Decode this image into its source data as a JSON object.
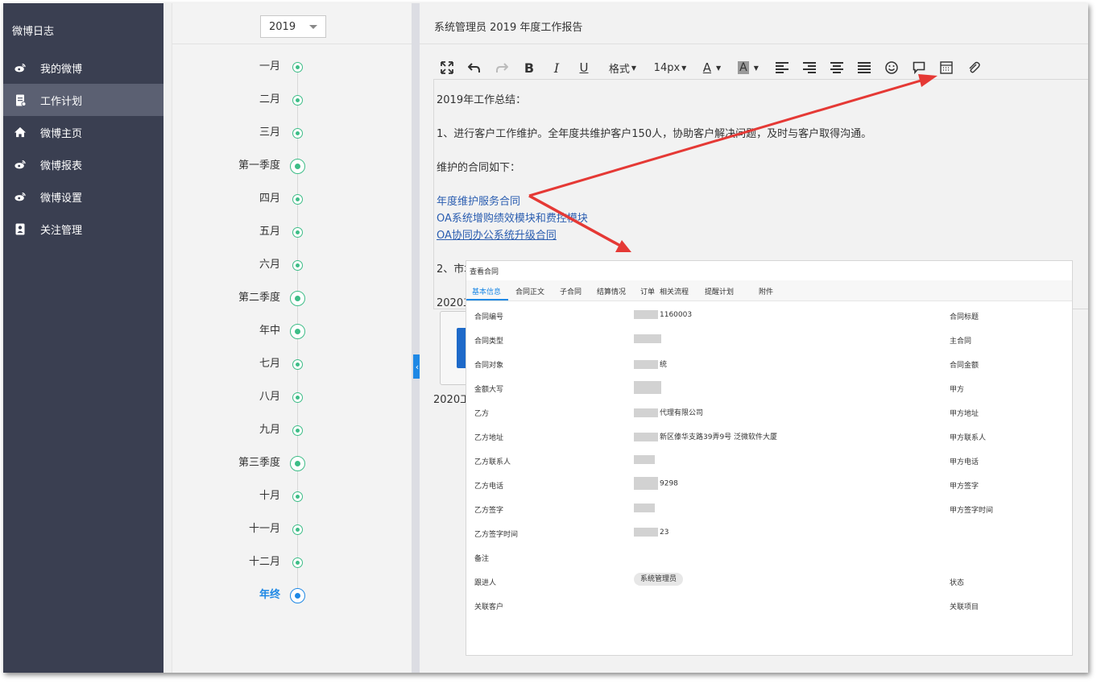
{
  "sidebar": {
    "title": "微博日志",
    "items": [
      {
        "label": "我的微博",
        "icon": "weibo-icon"
      },
      {
        "label": "工作计划",
        "icon": "document-icon"
      },
      {
        "label": "微博主页",
        "icon": "home-icon"
      },
      {
        "label": "微博报表",
        "icon": "weibo-icon"
      },
      {
        "label": "微博设置",
        "icon": "weibo-icon"
      },
      {
        "label": "关注管理",
        "icon": "contacts-icon"
      }
    ],
    "active_index": 1
  },
  "timeline": {
    "year": "2019",
    "items": [
      "一月",
      "二月",
      "三月",
      "第一季度",
      "四月",
      "五月",
      "六月",
      "第二季度",
      "年中",
      "七月",
      "八月",
      "九月",
      "第三季度",
      "十月",
      "十一月",
      "十二月",
      "年终"
    ],
    "current": "年终"
  },
  "editor": {
    "title": "系统管理员 2019 年度工作报告",
    "toolbar": {
      "format_label": "格式",
      "fontsize_label": "14px",
      "fontcolor_label": "A",
      "bgcolor_label": "A"
    },
    "content": {
      "line1": "2019年工作总结：",
      "line2": "1、进行客户工作维护。全年度共维护客户150人，协助客户解决问题，及时与客户取得沟通。",
      "line3": "维护的合同如下：",
      "link1": "年度维护服务合同",
      "link2": "OA系统增购绩效模块和费控模块",
      "link3": "OA协同办公系统升级合同",
      "line4_start": "2、市场",
      "line5_start": "2020工"
    },
    "attachment_name_start": "2020工"
  },
  "popup": {
    "title": "查看合同",
    "tabs": [
      "基本信息",
      "合同正文",
      "子合同",
      "结算情况",
      "订单",
      "相关流程",
      "提醒计划",
      "附件"
    ],
    "active_tab": 0,
    "left_fields": [
      {
        "label": "合同编号",
        "value": "1160003"
      },
      {
        "label": "合同类型",
        "value": ""
      },
      {
        "label": "合同对象",
        "value": "统"
      },
      {
        "label": "金额大写",
        "value": ""
      },
      {
        "label": "乙方",
        "value": "代理有限公司"
      },
      {
        "label": "乙方地址",
        "value": "新区傣华支路39弄9号 泛微软件大厦"
      },
      {
        "label": "乙方联系人",
        "value": ""
      },
      {
        "label": "乙方电话",
        "value": "9298"
      },
      {
        "label": "乙方签字",
        "value": ""
      },
      {
        "label": "乙方签字时间",
        "value": "23"
      },
      {
        "label": "备注",
        "value": ""
      },
      {
        "label": "跟进人",
        "value": "系统管理员"
      },
      {
        "label": "关联客户",
        "value": ""
      }
    ],
    "right_fields": [
      "合同标题",
      "主合同",
      "合同金额",
      "甲方",
      "甲方地址",
      "甲方联系人",
      "甲方电话",
      "甲方签字",
      "甲方签字时间",
      "",
      "",
      "状态",
      "关联项目"
    ]
  },
  "colors": {
    "sidebar_bg": "#3a3f51",
    "sidebar_active": "#5b6072",
    "accent_blue": "#1e88e5",
    "timeline_green": "#3dbd87",
    "arrow_red": "#e53935",
    "link_blue": "#2a5db0"
  }
}
